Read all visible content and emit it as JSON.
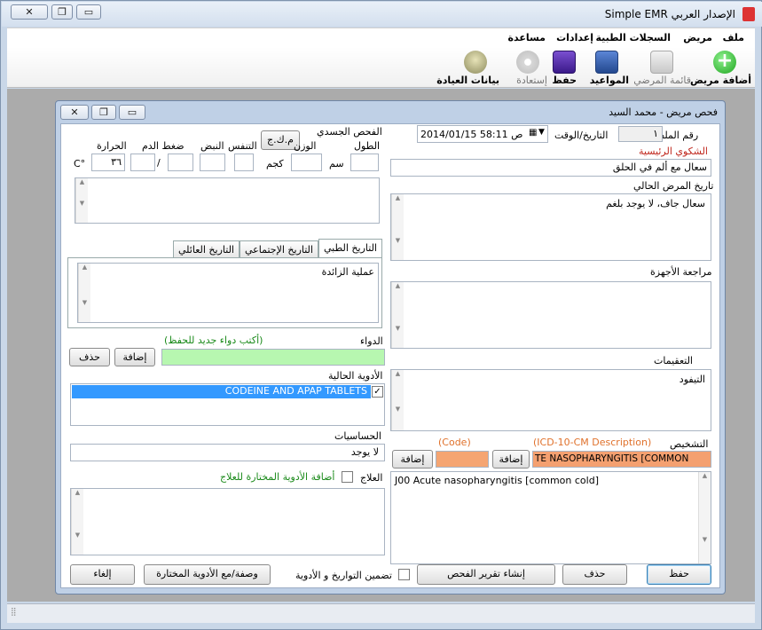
{
  "window": {
    "title": "Simple EMR الإصدار العربي",
    "controls": {
      "close": "✕",
      "restore": "❐",
      "minimize": "▭"
    }
  },
  "menu": [
    "ملف",
    "مريض",
    "السجلات الطبية",
    "إعدادات",
    "مساعدة"
  ],
  "toolbar": {
    "add_patient": "أضافة مريض",
    "patients_list": "قائمة المرضي",
    "appointments": "المواعيد",
    "save": "حفظ",
    "restore": "إستعادة",
    "clinic_data": "بيانات العيادة"
  },
  "child": {
    "title": "فحص مريض - محمد السيد",
    "file_no_label": "رقم الملف",
    "file_no": "١",
    "datetime_label": "التاريخ/الوقت",
    "datetime": "2014/01/15 58:11 ص",
    "chief_complaint_label": "الشكوي الرئيسية",
    "chief_complaint": "سعال مع ألم في الحلق",
    "hpi_label": "تاريخ المرض الحالي",
    "hpi": "سعال جاف، لا يوجد بلغم",
    "ros_label": "مراجعة الأجهزة",
    "ros": "",
    "complications_label": "التعقيمات",
    "complications": "التيفود",
    "diagnosis_label": "التشخيص",
    "icd_desc_label": "(ICD-10-CM Description)",
    "code_label": "(Code)",
    "diagnosis_value": "TE NASOPHARYNGITIS [COMMON COLD]",
    "add_label": "إضافة",
    "diagnosis_list": "J00 Acute nasopharyngitis [common cold]",
    "physical_exam_label": "الفحص الجسدي",
    "bmi_button": "م.ك.ج",
    "height_label": "الطول",
    "height_unit": "سم",
    "weight_label": "الوزن",
    "weight_unit": "كجم",
    "resp_label": "التنفس",
    "pulse_label": "النبض",
    "bp_label": "ضغط الدم",
    "bp_sep": "/",
    "temp_label": "الحرارة",
    "temp_value": "٣٦",
    "temp_unit": "C°",
    "tabs": [
      "التاريخ الطبي",
      "التاريخ الإجتماعي",
      "التاريخ العائلي"
    ],
    "medical_history": "عملية الزائدة",
    "drug_label": "الدواء",
    "drug_hint": "(أكتب دواء جديد للحفظ)",
    "delete_label": "حذف",
    "current_meds_label": "الأدوية الحالية",
    "current_meds": [
      "CODEINE AND APAP TABLETS"
    ],
    "allergies_label": "الحساسيات",
    "allergies": "لا يوجد",
    "treatment_label": "العلاج",
    "add_selected_meds": "أضافة الأدوية المختارة للعلاج",
    "buttons": {
      "save": "حفظ",
      "delete": "حذف",
      "create_report": "إنشاء تقرير الفحص",
      "include_history": "تضمين التواريخ و الأدوية",
      "prescription": "وصفة/مع الأدوية المختارة",
      "cancel": "إلغاء"
    }
  },
  "colors": {
    "selection": "#3399ff",
    "drug_input": "#b7f7b0",
    "code_input": "#f5a572",
    "diagnosis_input": "#f4a070"
  }
}
